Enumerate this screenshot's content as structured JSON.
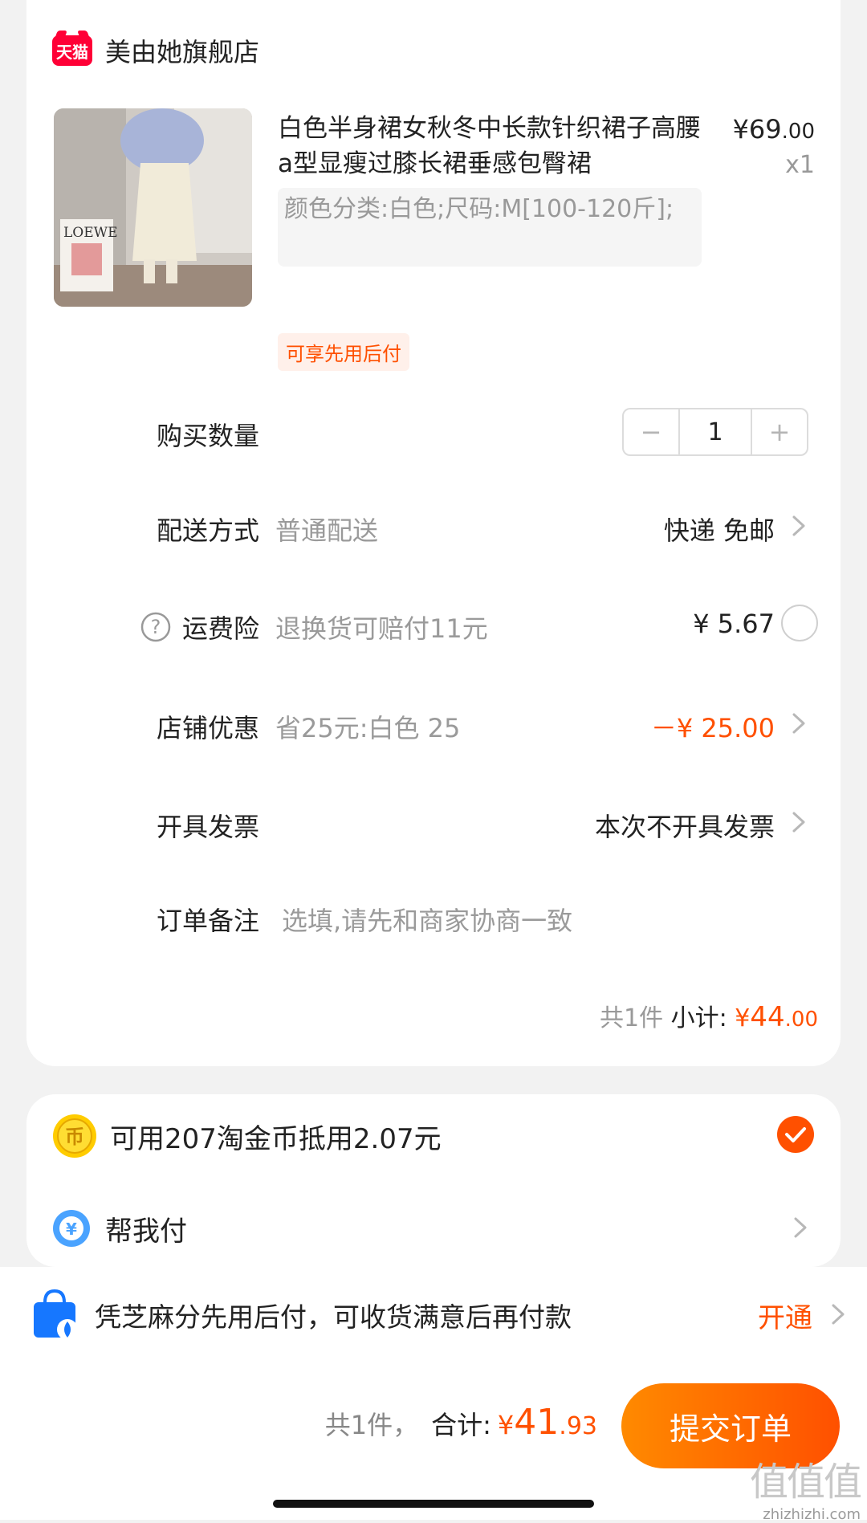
{
  "store": {
    "badge_text": "天猫",
    "name": "美由她旗舰店"
  },
  "product": {
    "title": "白色半身裙女秋冬中长款针织裙子高腰a型显瘦过膝长裙垂感包臀裙",
    "sku": "颜色分类:白色;尺码:M[100-120斤];",
    "price_yuan": "¥69",
    "price_cents": ".00",
    "quantity_text": "x1",
    "tag": "可享先用后付",
    "image_text": "LOEWE"
  },
  "rows": {
    "quantity": {
      "label": "购买数量",
      "minus": "−",
      "value": "1",
      "plus": "+"
    },
    "delivery": {
      "label": "配送方式",
      "desc": "普通配送",
      "value": "快递 免邮"
    },
    "insurance": {
      "label": "运费险",
      "desc": "退换货可赔付11元",
      "value": "¥ 5.67"
    },
    "discount": {
      "label": "店铺优惠",
      "desc": "省25元:白色 25",
      "value": "－¥ 25.00"
    },
    "invoice": {
      "label": "开具发票",
      "value": "本次不开具发票"
    },
    "note": {
      "label": "订单备注",
      "placeholder": "选填,请先和商家协商一致"
    }
  },
  "subtotal": {
    "count_text": "共1件",
    "label": "小计:",
    "currency": "¥",
    "yuan": "44",
    "cents": ".00"
  },
  "coins": {
    "text": "可用207淘金币抵用2.07元",
    "checked": true,
    "icon_glyph": "币"
  },
  "help_pay": {
    "text": "帮我付",
    "icon_glyph": "¥"
  },
  "credit": {
    "text": "凭芝麻分先用后付，可收货满意后再付款",
    "action": "开通"
  },
  "total": {
    "count_text": "共1件，",
    "label": "合计:",
    "currency": "¥",
    "yuan": "41",
    "cents": ".93"
  },
  "submit_label": "提交订单",
  "watermark": {
    "logo": "值值值",
    "url": "zhizhizhi.com"
  },
  "colors": {
    "accent": "#ff5000",
    "tmall_red": "#ff0036",
    "background": "#f2f2f2"
  },
  "icons": [
    "tmall-logo",
    "chevron-right-icon",
    "help-icon",
    "radio-circle",
    "coin-icon",
    "check-icon",
    "yuan-circle-icon",
    "shopping-bag-icon"
  ]
}
